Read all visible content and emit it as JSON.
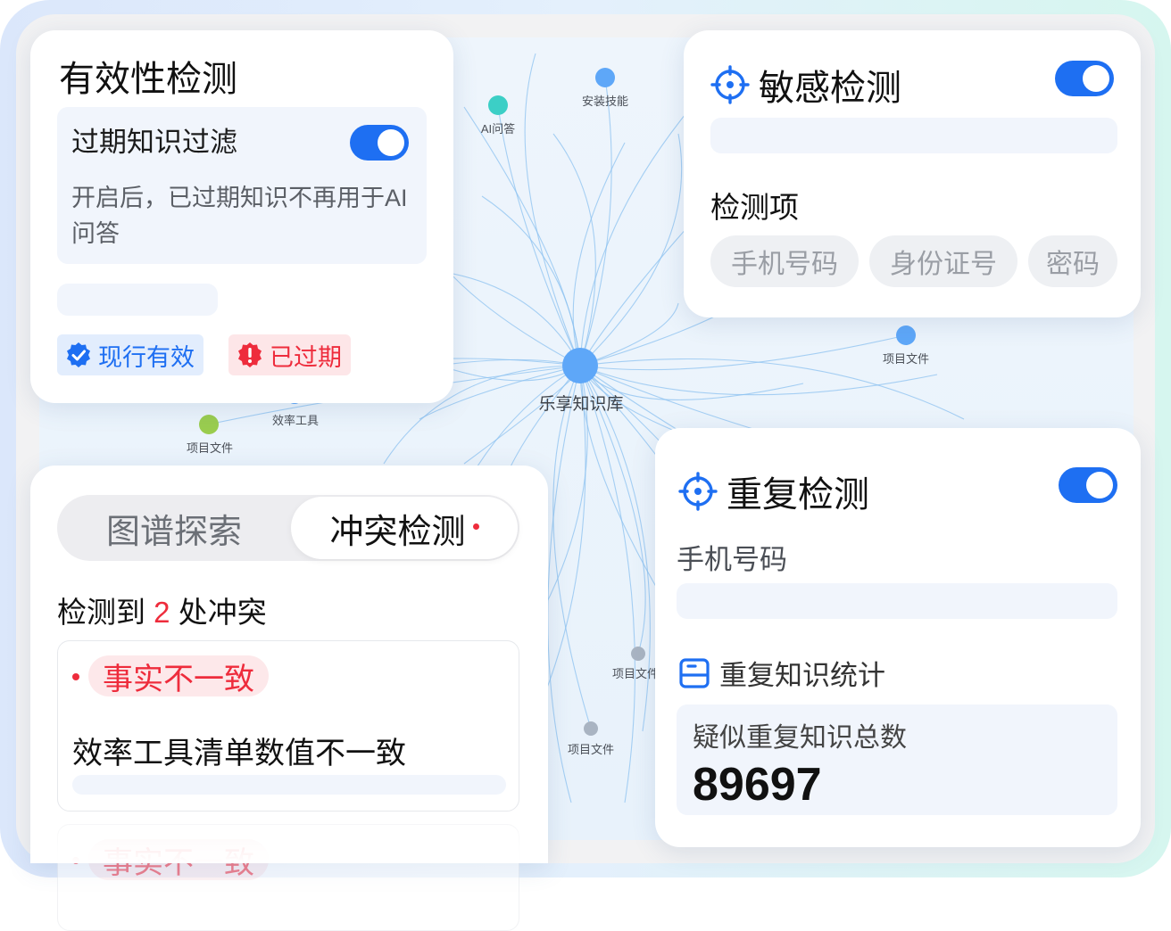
{
  "graph": {
    "center_label": "乐享知识库",
    "nodes": [
      {
        "label": "AI问答",
        "color": "#3ccfc6"
      },
      {
        "label": "安装技能",
        "color": "#5ea7f8"
      },
      {
        "label": "项目文件",
        "color": "#5ea7f8"
      },
      {
        "label": "效率工具",
        "color": "#5ea7f8"
      },
      {
        "label": "项目文件",
        "color": "#9acd4f"
      },
      {
        "label": "项目文件",
        "color": "#a9b4c2"
      },
      {
        "label": "项目文件",
        "color": "#a9b4c2"
      }
    ]
  },
  "validity": {
    "title": "有效性检测",
    "option_title": "过期知识过滤",
    "option_desc": "开启后，已过期知识不再用于AI问答",
    "toggle_on": true,
    "tag_valid": "现行有效",
    "tag_expired": "已过期"
  },
  "sensitive": {
    "title": "敏感检测",
    "toggle_on": true,
    "items_label": "检测项",
    "chips": [
      "手机号码",
      "身份证号",
      "密码"
    ]
  },
  "duplicate": {
    "title": "重复检测",
    "toggle_on": true,
    "subtitle": "手机号码",
    "stats_label": "重复知识统计",
    "total_label": "疑似重复知识总数",
    "total_value": "89697"
  },
  "conflict": {
    "tabs": [
      "图谱探索",
      "冲突检测"
    ],
    "count_prefix": "检测到",
    "count": "2",
    "count_suffix": "处冲突",
    "items": [
      {
        "badge": "事实不一致",
        "desc": "效率工具清单数值不一致"
      },
      {
        "badge": "事实不一致",
        "desc": ""
      }
    ]
  },
  "colors": {
    "accent": "#1e6ff2",
    "danger": "#ee2c3c"
  }
}
